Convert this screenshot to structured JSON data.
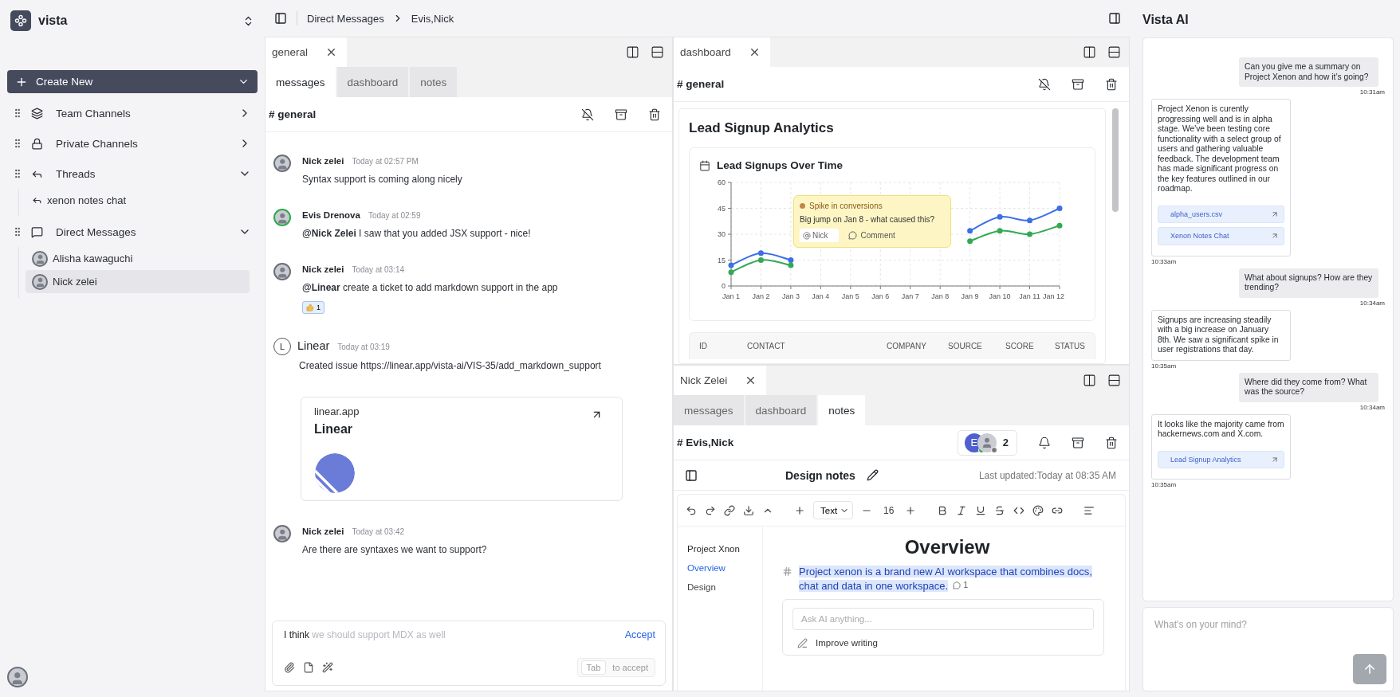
{
  "workspace": {
    "name": "vista"
  },
  "create_button": {
    "label": "Create New"
  },
  "sidebar": {
    "sections": [
      {
        "kind": "team",
        "label": "Team Channels",
        "expanded": false
      },
      {
        "kind": "private",
        "label": "Private Channels",
        "expanded": false
      },
      {
        "kind": "threads",
        "label": "Threads",
        "expanded": true,
        "children": [
          {
            "kind": "thread",
            "label": "xenon notes chat",
            "selected": false
          }
        ]
      },
      {
        "kind": "dm",
        "label": "Direct Messages",
        "expanded": true,
        "children": [
          {
            "kind": "person",
            "label": "Alisha kawaguchi",
            "selected": false
          },
          {
            "kind": "person",
            "label": "Nick zelei",
            "selected": true
          }
        ]
      }
    ]
  },
  "breadcrumb": [
    "Direct Messages",
    "Evis,Nick"
  ],
  "panes": [
    {
      "kind": "messages",
      "tab": "general",
      "subtabs": [
        {
          "label": "messages",
          "selected": true
        },
        {
          "label": "dashboard",
          "selected": false
        },
        {
          "label": "notes",
          "selected": false
        }
      ],
      "channel": "# general",
      "muted": true,
      "messages": [
        {
          "kind": "user",
          "author": "Nick zelei",
          "time": "Today at 02:57 PM",
          "text": "Syntax support is coming along nicely",
          "online": false
        },
        {
          "kind": "user",
          "author": "Evis Drenova",
          "time": "Today at 02:59",
          "text": "**@Nick Zelei** I saw that you added JSX support - nice!",
          "online": true
        },
        {
          "kind": "user",
          "author": "Nick zelei",
          "time": "Today at 03:14",
          "text": "**@Linear** create a ticket to add markdown support in the app",
          "online": false,
          "reactions": [
            {
              "count": "1"
            }
          ]
        },
        {
          "kind": "bot",
          "author": "Linear",
          "initial": "L",
          "time": "Today at 03:19",
          "text": "Created issue https://linear.app/vista-ai/VIS-35/add_markdown_support",
          "card": {
            "site": "linear.app",
            "title": "Linear"
          }
        },
        {
          "kind": "user",
          "author": "Nick zelei",
          "time": "Today at 03:42",
          "text": "Are there are syntaxes we want to support?",
          "online": false
        }
      ],
      "composer": {
        "typed": "I think",
        "suggestion": "we should support MDX as well",
        "accept": "Accept",
        "key": "Tab",
        "hint": "to accept"
      }
    },
    {
      "kind": "dashboard",
      "tab": "dashboard",
      "channel": "# general",
      "muted": true,
      "title": "Lead Signup Analytics",
      "chart_title": "Lead Signups Over Time",
      "chart_data": {
        "type": "line",
        "grid": true,
        "x": [
          "Jan 1",
          "Jan 2",
          "Jan 3",
          "Jan 4",
          "Jan 5",
          "Jan 6",
          "Jan 7",
          "Jan 8",
          "Jan 9",
          "Jan 10",
          "Jan 11",
          "Jan 12"
        ],
        "ylim": [
          0,
          60
        ],
        "yticks": [
          0,
          15,
          30,
          45,
          60
        ],
        "series": [
          {
            "color": "#3b6fe8",
            "marker": "circle",
            "values": [
              12,
              19,
              15,
              null,
              null,
              null,
              null,
              null,
              32,
              40,
              38,
              45
            ]
          },
          {
            "color": "#34a853",
            "marker": "circle",
            "values": [
              8,
              15,
              12,
              null,
              null,
              null,
              null,
              null,
              26,
              32,
              30,
              35
            ]
          }
        ]
      },
      "comment": {
        "title": "Spike in conversions",
        "text": "Big jump on Jan 8 - what caused this?",
        "mention": "Nick",
        "action": "Comment"
      },
      "table": {
        "columns": [
          "ID",
          "CONTACT",
          "COMPANY",
          "SOURCE",
          "SCORE",
          "STATUS"
        ]
      }
    },
    {
      "kind": "notes",
      "tab": "Nick Zelei",
      "subtabs": [
        {
          "label": "messages",
          "selected": false
        },
        {
          "label": "dashboard",
          "selected": false
        },
        {
          "label": "notes",
          "selected": true
        }
      ],
      "channel": "# Evis,Nick",
      "muted": false,
      "members": {
        "avatars": [
          {
            "initial": "E",
            "online": true
          },
          {
            "online": false
          }
        ],
        "count": "2"
      },
      "notes": {
        "title": "Design notes",
        "updated": "Last updated:Today at 08:35 AM",
        "block_type": "Text",
        "font_size": "16",
        "outline": {
          "title": "Project Xnon",
          "items": [
            {
              "label": "Overview",
              "selected": true
            },
            {
              "label": "Design",
              "selected": false
            }
          ]
        },
        "heading": "Overview",
        "paragraph": "Project xenon is a brand new AI workspace that combines docs, chat and data in one workspace.",
        "comment_count": "1",
        "ai": {
          "placeholder": "Ask AI anything...",
          "actions": [
            "Improve writing"
          ]
        }
      }
    }
  ],
  "assistant": {
    "title": "Vista AI",
    "messages": [
      {
        "kind": "user",
        "text": "Can you give me a summary on Project Xenon and how it’s going?",
        "time": "10:31am"
      },
      {
        "kind": "assistant",
        "text": "Project Xenon is curently progressing well and is in alpha stage. We've been testing core functionality with a select group of users and gathering valuable feedback. The development team has made significant progress on the key features outlined in our roadmap.",
        "links": [
          "alpha_users.csv",
          "Xenon Notes Chat"
        ],
        "time": "10:33am"
      },
      {
        "kind": "user",
        "text": "What about signups? How are they trending?",
        "time": "10:34am"
      },
      {
        "kind": "assistant",
        "text": "Signups are increasing steadily with a big increase on January 8th. We saw a significant spike in user registrations that day.",
        "time": "10:35am"
      },
      {
        "kind": "user",
        "text": "Where did they come from? What was the source?",
        "time": "10:34am"
      },
      {
        "kind": "assistant",
        "text": "It looks like the majority came from hackernews.com and X.com.",
        "links": [
          "Lead Signup Analytics"
        ],
        "time": "10:35am"
      }
    ],
    "placeholder": "What’s on your mind?"
  }
}
